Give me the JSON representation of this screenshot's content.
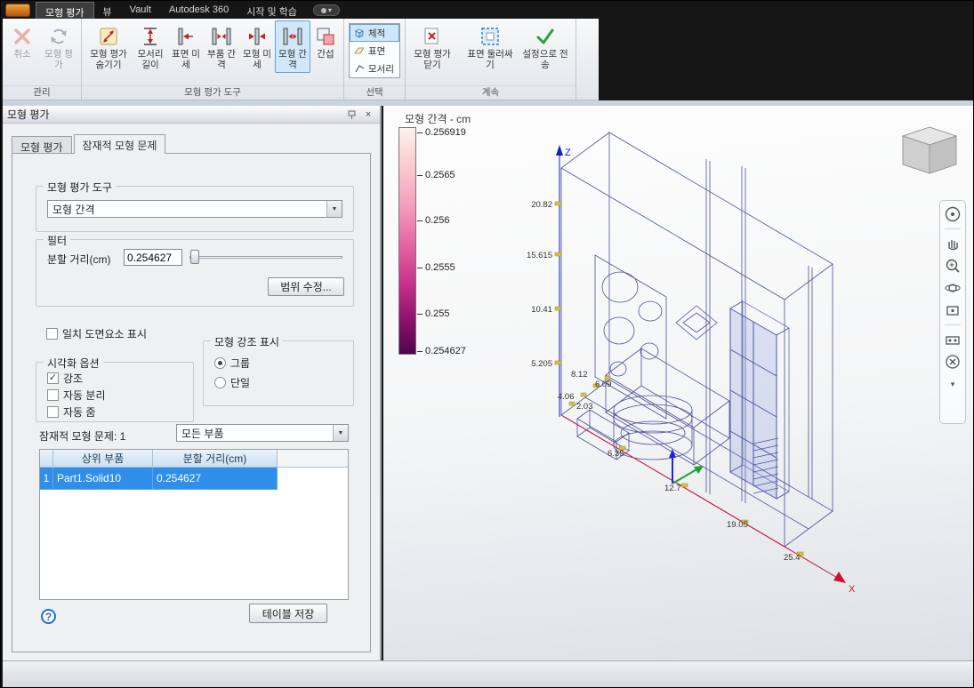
{
  "icons": {
    "dropdown_arrow": "▼",
    "close": "×",
    "check": "✓",
    "help": "?"
  },
  "colors": {
    "selection_blue": "#2f8fe8",
    "highlight_blue": "#d2e8fa",
    "legend_top": "#fdf2ea",
    "legend_bottom": "#4e0550"
  },
  "titlebar": {
    "tabs": [
      {
        "label": "모형 평가"
      },
      {
        "label": "뷰"
      },
      {
        "label": "Vault"
      },
      {
        "label": "Autodesk 360"
      },
      {
        "label": "시작 및 학습"
      }
    ]
  },
  "ribbon": {
    "manage": {
      "label": "관리",
      "cancel": "취소",
      "evaluate": "모형 평가"
    },
    "tools": {
      "label": "모형 평가 도구",
      "hide": "모형 평가 숨기기",
      "edge_length": "모서리 길이",
      "surface_fine": "표면 미세",
      "part_gap": "부품 간격",
      "model_fine": "모형 미세",
      "model_gap": "모형 간격",
      "interference": "간섭"
    },
    "selection": {
      "label": "선택",
      "volume": "체적",
      "surface": "표면",
      "edge": "모서리"
    },
    "cont": {
      "label": "계속",
      "close": "모형 평가 닫기",
      "wrap": "표면 둘러싸기",
      "send": "설정으로 전송"
    }
  },
  "panel": {
    "title": "모형 평가",
    "tabs": [
      {
        "label": "모형 평가"
      },
      {
        "label": "잠재적 모형 문제"
      }
    ],
    "tool_group": {
      "label": "모형 평가 도구",
      "dropdown_value": "모형 간격"
    },
    "filter_group": {
      "label": "필터",
      "distance_label": "분할 거리(cm)",
      "distance_value": "0.254627",
      "range_button": "범위 수정...",
      "match_checkbox": "일치 도면요소 표시"
    },
    "visual_group": {
      "label": "시각화 옵션",
      "highlight": "강조",
      "auto_isolate": "자동 분리",
      "auto_zoom": "자동 줌"
    },
    "highlight_group": {
      "label": "모형 강조 표시",
      "group_radio": "그룹",
      "single_radio": "단일"
    },
    "problems_label": "잠재적 모형 문제: 1",
    "parts_dropdown": "모든 부품",
    "table": {
      "headers": [
        "상위 부품",
        "분할 거리(cm)"
      ],
      "rows": [
        {
          "num": "1",
          "part": "Part1.Solid10",
          "distance": "0.254627"
        }
      ]
    },
    "save_button": "테이블 저장"
  },
  "viewport": {
    "title": "모형 간격 - cm",
    "legend_labels": [
      "0.256919",
      "0.2565",
      "0.256",
      "0.2555",
      "0.255",
      "0.254627"
    ],
    "axes": {
      "x": "X",
      "z": "Z"
    },
    "x_ticks": [
      "6.35",
      "12.7",
      "19.05",
      "25.4"
    ],
    "z_ticks": [
      "20.82",
      "15.615",
      "10.41",
      "5.205"
    ],
    "y_ticks": [
      "2.03",
      "4.06",
      "6.09",
      "8.12"
    ]
  }
}
